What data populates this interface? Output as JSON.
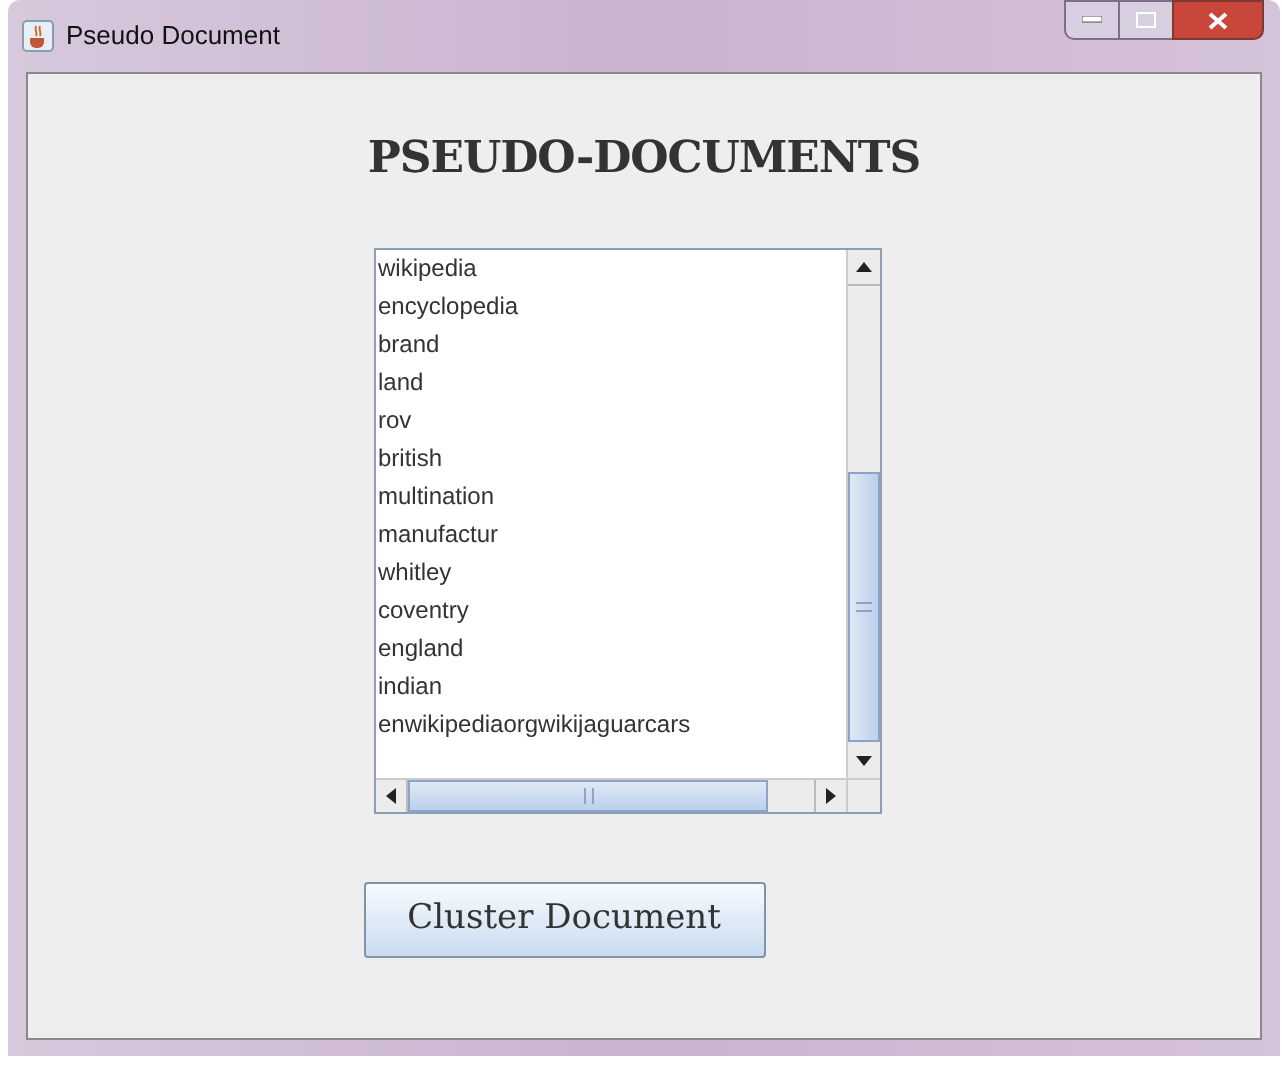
{
  "window": {
    "title": "Pseudo Document"
  },
  "heading": "PSEUDO-DOCUMENTS",
  "list": {
    "items": [
      "wikipedia",
      "encyclopedia",
      "brand",
      "land",
      "rov",
      "british",
      "multination",
      "manufactur",
      "whitley",
      "coventry",
      "england",
      "indian",
      "enwikipediaorgwikijaguarcars"
    ]
  },
  "button": {
    "label": "Cluster Document"
  }
}
